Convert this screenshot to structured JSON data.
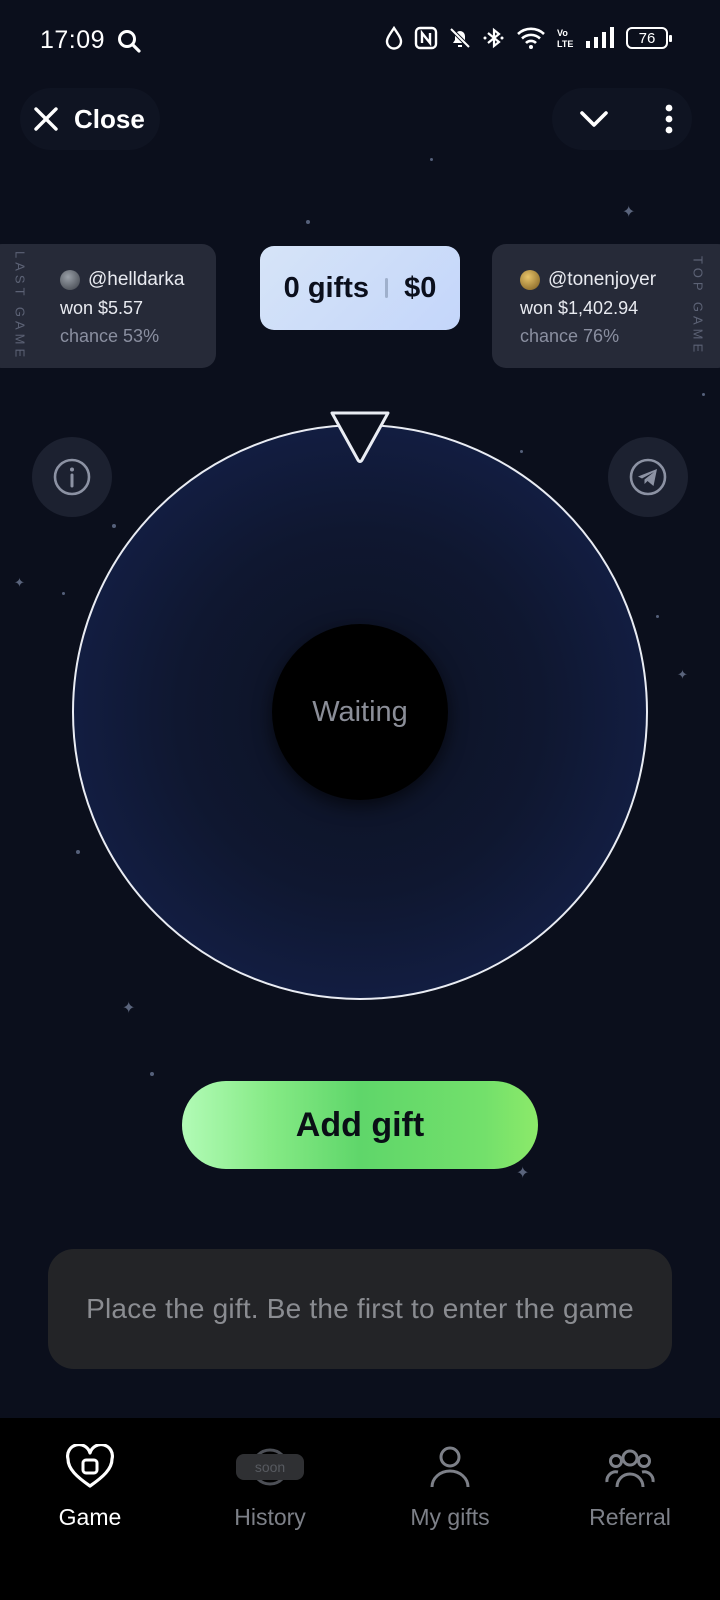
{
  "status_bar": {
    "time": "17:09",
    "battery": "76"
  },
  "top_bar": {
    "close_label": "Close"
  },
  "last_game": {
    "label": "LAST GAME",
    "user": "@helldarka",
    "won": "won $5.57",
    "chance": "chance 53%"
  },
  "top_game": {
    "label": "TOP GAME",
    "user": "@tonenjoyer",
    "won": "won $1,402.94",
    "chance": "chance 76%"
  },
  "pot": {
    "gifts": "0 gifts",
    "amount": "$0"
  },
  "wheel": {
    "status": "Waiting"
  },
  "actions": {
    "add_gift_label": "Add gift"
  },
  "hint": {
    "text": "Place the gift. Be the first to enter the game"
  },
  "nav": {
    "items": [
      {
        "label": "Game",
        "icon": "heart-gift-icon",
        "active": true
      },
      {
        "label": "History",
        "icon": "history-icon",
        "badge": "soon"
      },
      {
        "label": "My gifts",
        "icon": "user-icon"
      },
      {
        "label": "Referral",
        "icon": "users-icon"
      }
    ]
  },
  "colors": {
    "background": "#0b0f1c",
    "accent_green": "#6fde6a",
    "pill_blue": "#cfdff8"
  }
}
